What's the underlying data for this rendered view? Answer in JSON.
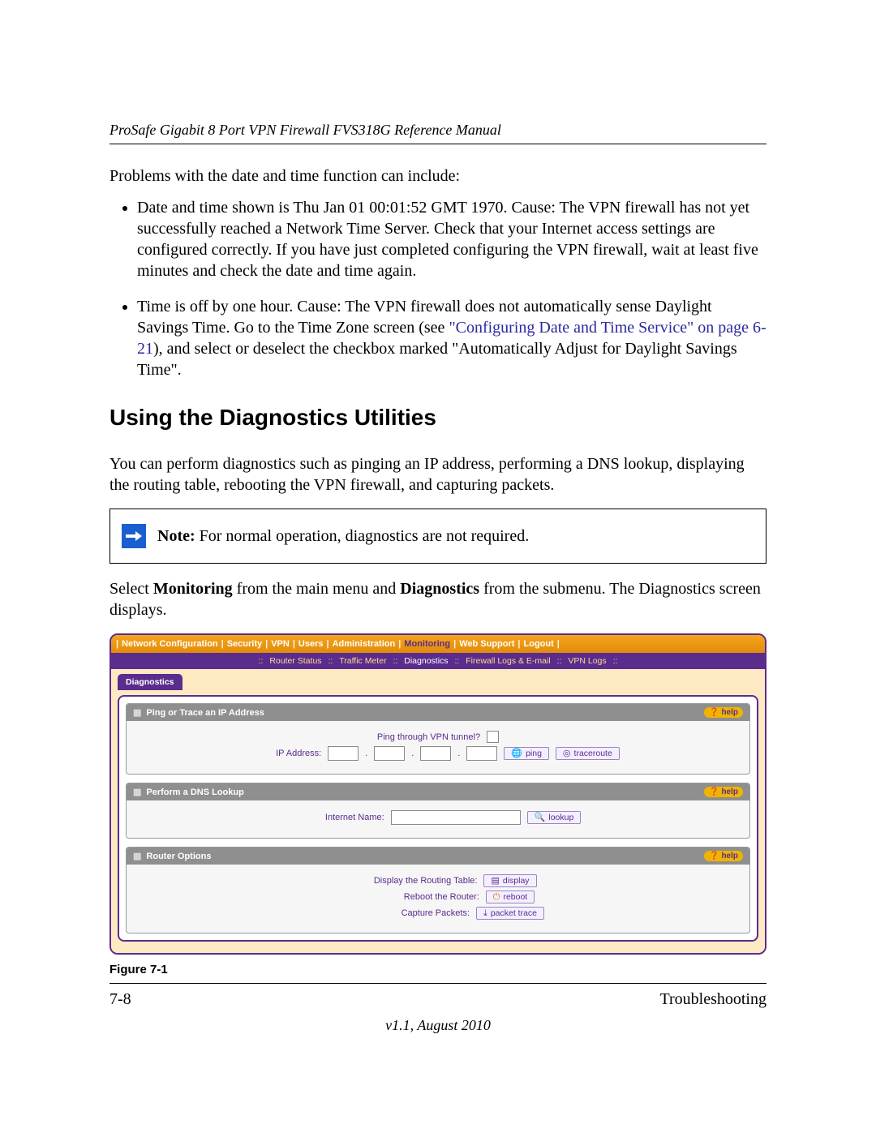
{
  "header": {
    "running_head": "ProSafe Gigabit 8 Port VPN Firewall FVS318G Reference Manual"
  },
  "intro": "Problems with the date and time function can include:",
  "bullets": [
    {
      "text_before": "Date and time shown is Thu Jan 01 00:01:52 GMT 1970. Cause: The VPN firewall has not yet successfully reached a Network Time Server. Check that your Internet access settings are configured correctly. If you have just completed configuring the VPN firewall, wait at least five minutes and check the date and time again.",
      "link": "",
      "text_after": ""
    },
    {
      "text_before": "Time is off by one hour. Cause: The VPN firewall does not automatically sense Daylight Savings Time. Go to the Time Zone screen (see ",
      "link": "\"Configuring Date and Time Service\" on page 6-21",
      "text_after": "), and select or deselect the checkbox marked \"Automatically Adjust for Daylight Savings Time\"."
    }
  ],
  "section_title": "Using the Diagnostics Utilities",
  "section_para": "You can perform diagnostics such as pinging an IP address, performing a DNS lookup, displaying the routing table, rebooting the VPN firewall, and capturing packets.",
  "note": {
    "label": "Note:",
    "text": " For normal operation, diagnostics are not required."
  },
  "select_para": {
    "before": "Select ",
    "bold1": "Monitoring",
    "mid": " from the main menu and ",
    "bold2": "Diagnostics",
    "after": " from the submenu. The Diagnostics screen displays."
  },
  "ui": {
    "menu": [
      "Network Configuration",
      "Security",
      "VPN",
      "Users",
      "Administration",
      "Monitoring",
      "Web Support",
      "Logout"
    ],
    "menu_active_index": 5,
    "submenu": [
      "Router Status",
      "Traffic Meter",
      "Diagnostics",
      "Firewall Logs & E-mail",
      "VPN Logs"
    ],
    "submenu_active_index": 2,
    "tab": "Diagnostics",
    "help_label": "help",
    "blocks": {
      "ping": {
        "title": "Ping or Trace an IP Address",
        "row1_label": "Ping through VPN tunnel?",
        "row2_label": "IP Address:",
        "btn_ping": "ping",
        "btn_trace": "traceroute"
      },
      "dns": {
        "title": "Perform a DNS Lookup",
        "row_label": "Internet Name:",
        "btn_lookup": "lookup"
      },
      "router": {
        "title": "Router Options",
        "row1_label": "Display the Routing Table:",
        "btn_display": "display",
        "row2_label": "Reboot the Router:",
        "btn_reboot": "reboot",
        "row3_label": "Capture Packets:",
        "btn_packet": "packet trace"
      }
    }
  },
  "figure_caption": "Figure 7-1",
  "footer": {
    "page": "7-8",
    "section": "Troubleshooting",
    "version": "v1.1, August 2010"
  }
}
